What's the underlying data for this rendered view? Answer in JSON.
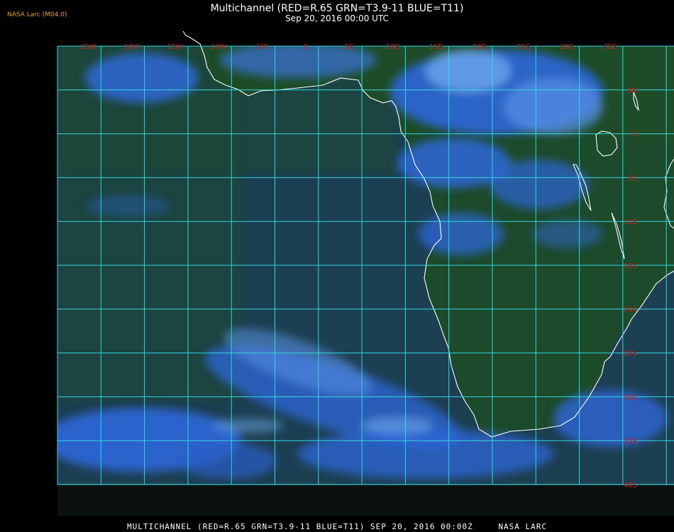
{
  "header": {
    "badge": "NASA Larc (M04.0)",
    "title": "Multichannel (RED=R.65 GRN=T3.9-11 BLUE=T11)",
    "subtitle": "Sep 20, 2016 00:00 UTC"
  },
  "footer": {
    "product": "MULTICHANNEL (RED=R.65 GRN=T3.9-11 BLUE=T11) SEP 20, 2016 00:00Z",
    "credit": "NASA LARC"
  },
  "map": {
    "lon_labels": [
      "25W",
      "20W",
      "15W",
      "10W",
      "5W",
      "0",
      "5E",
      "10E",
      "15E",
      "20E",
      "25E",
      "30E",
      "35E"
    ],
    "lat_labels": [
      "5N",
      "0",
      "5S",
      "10S",
      "15S",
      "20S",
      "25S",
      "30S",
      "35S",
      "40S"
    ],
    "colors": {
      "grid": "#33d6e0",
      "label": "#cc2020",
      "coast": "#ffffff",
      "ocean": "#1d3f52",
      "land": "#1d4a2a",
      "cloud": "#2f67d8",
      "cloud_bright": "#6ea8ee",
      "background": "#000000"
    }
  }
}
